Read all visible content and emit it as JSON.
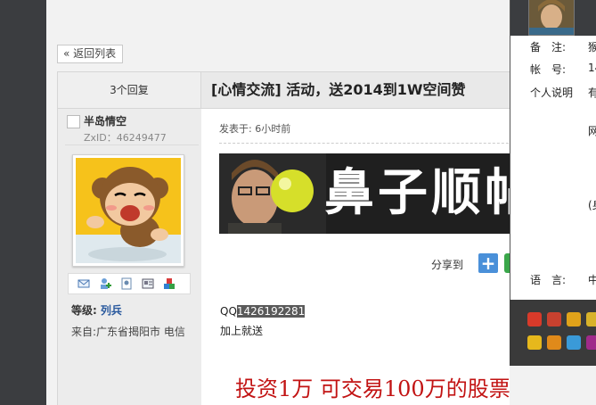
{
  "nav": {
    "back_label": "« 返回列表"
  },
  "thread": {
    "reply_count": "3个回复",
    "title": "[心情交流] 活动，送2014到1W空间赞"
  },
  "author": {
    "name": "半岛情空",
    "zxid": "ZxID：46249477",
    "level_label": "等级:",
    "level_value": "列兵",
    "from": "来自:广东省揭阳市 电信",
    "action_icons": [
      "mail-icon",
      "add-friend-icon",
      "profile-icon",
      "card-icon",
      "medal-icon"
    ]
  },
  "post": {
    "time": "发表于: 6小时前",
    "banner_text": "鼻子顺帖",
    "share_label": "分享到",
    "qq_prefix": "QQ",
    "qq_number": "1426192281",
    "add_text": "加上就送",
    "ad_text": "投资1万 可交易100万的股票"
  },
  "profile_card": {
    "rows": [
      {
        "label": "备　注:",
        "value": "猴"
      },
      {
        "label": "帐　号:",
        "value": "14"
      },
      {
        "label": "个人说明",
        "value": "有"
      },
      {
        "label": "",
        "value": "网"
      },
      {
        "label": "",
        "value": "(身"
      },
      {
        "label": "语　言:",
        "value": "中"
      }
    ]
  },
  "colors": {
    "title_text": "#222222",
    "level_value": "#2a5a9e",
    "ad_text": "#c21313",
    "share_blue": "#4a90d9",
    "share_green": "#3aa74a"
  }
}
